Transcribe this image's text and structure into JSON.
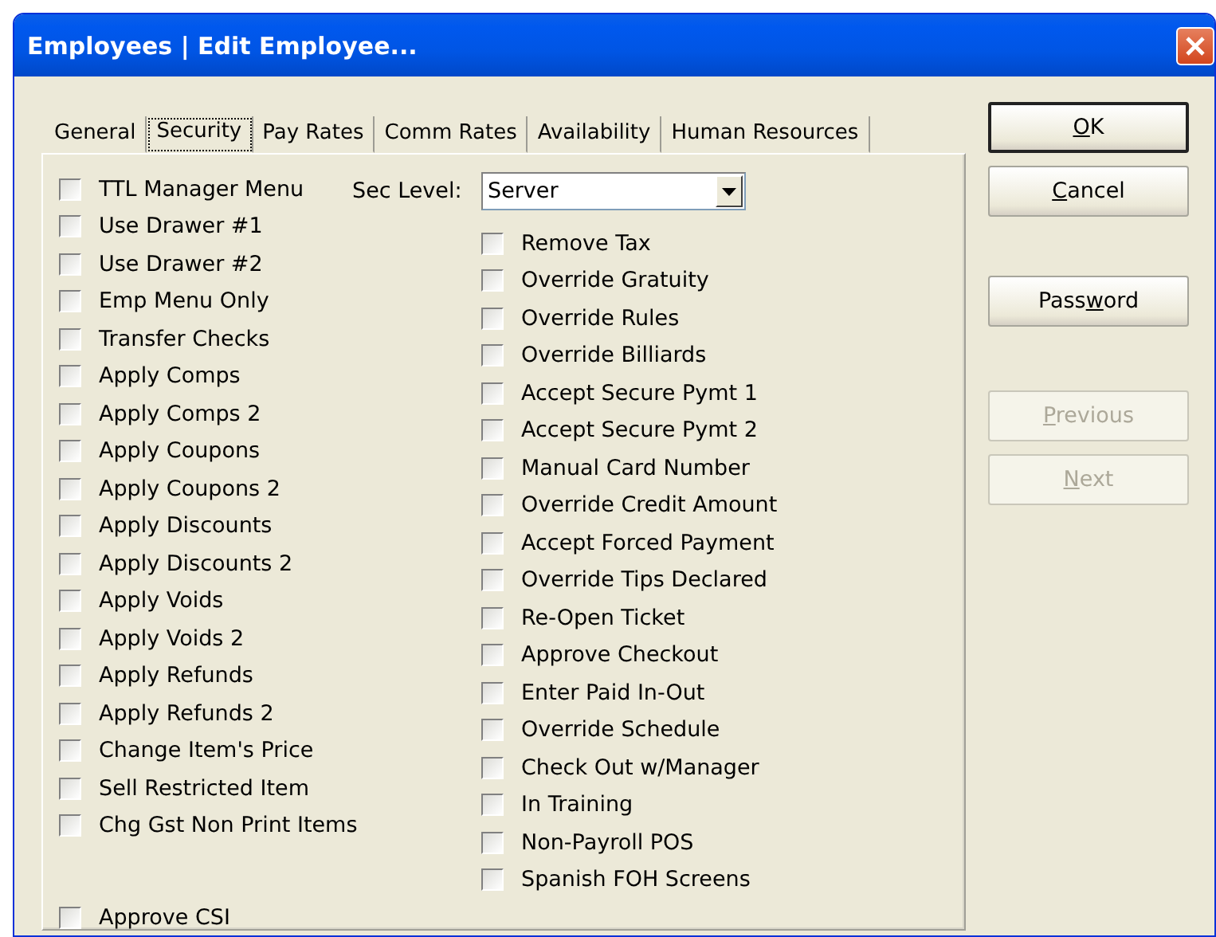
{
  "window": {
    "title": "Employees | Edit Employee..."
  },
  "tabs": [
    {
      "label": "General",
      "selected": false
    },
    {
      "label": "Security",
      "selected": true
    },
    {
      "label": "Pay Rates",
      "selected": false
    },
    {
      "label": "Comm Rates",
      "selected": false
    },
    {
      "label": "Availability",
      "selected": false
    },
    {
      "label": "Human Resources",
      "selected": false
    }
  ],
  "sec_level": {
    "label": "Sec Level:",
    "value": "Server"
  },
  "left_checkboxes": [
    {
      "label": "TTL Manager Menu",
      "checked": false
    },
    {
      "label": "Use Drawer #1",
      "checked": false
    },
    {
      "label": "Use Drawer #2",
      "checked": false
    },
    {
      "label": "Emp Menu Only",
      "checked": false
    },
    {
      "label": "Transfer Checks",
      "checked": false
    },
    {
      "label": "Apply Comps",
      "checked": false
    },
    {
      "label": "Apply Comps 2",
      "checked": false
    },
    {
      "label": "Apply Coupons",
      "checked": false
    },
    {
      "label": "Apply Coupons 2",
      "checked": false
    },
    {
      "label": "Apply Discounts",
      "checked": false
    },
    {
      "label": "Apply Discounts 2",
      "checked": false
    },
    {
      "label": "Apply Voids",
      "checked": false
    },
    {
      "label": "Apply Voids 2",
      "checked": false
    },
    {
      "label": "Apply Refunds",
      "checked": false
    },
    {
      "label": "Apply Refunds 2",
      "checked": false
    },
    {
      "label": "Change Item's Price",
      "checked": false
    },
    {
      "label": "Sell Restricted Item",
      "checked": false
    },
    {
      "label": "Chg Gst Non Print Items",
      "checked": false
    }
  ],
  "bottom_checkbox": {
    "label": "Approve CSI",
    "checked": false
  },
  "right_checkboxes": [
    {
      "label": "Remove Tax",
      "checked": false
    },
    {
      "label": "Override Gratuity",
      "checked": false
    },
    {
      "label": "Override Rules",
      "checked": false
    },
    {
      "label": "Override Billiards",
      "checked": false
    },
    {
      "label": "Accept Secure Pymt 1",
      "checked": false
    },
    {
      "label": "Accept Secure Pymt 2",
      "checked": false
    },
    {
      "label": "Manual Card Number",
      "checked": false
    },
    {
      "label": "Override Credit Amount",
      "checked": false
    },
    {
      "label": "Accept Forced Payment",
      "checked": false
    },
    {
      "label": "Override Tips Declared",
      "checked": false
    },
    {
      "label": "Re-Open Ticket",
      "checked": false
    },
    {
      "label": "Approve Checkout",
      "checked": false
    },
    {
      "label": "Enter Paid In-Out",
      "checked": false
    },
    {
      "label": "Override Schedule",
      "checked": false
    },
    {
      "label": "Check Out w/Manager",
      "checked": false
    },
    {
      "label": "In Training",
      "checked": false
    },
    {
      "label": "Non-Payroll POS",
      "checked": false
    },
    {
      "label": "Spanish FOH Screens",
      "checked": false
    }
  ],
  "buttons": [
    {
      "key": "O",
      "post": "K",
      "disabled": false,
      "default": true
    },
    {
      "key": "C",
      "post": "ancel",
      "disabled": false,
      "default": false
    },
    {
      "pre": "Pass",
      "key": "w",
      "post": "ord",
      "disabled": false,
      "default": false
    },
    {
      "key": "P",
      "post": "revious",
      "disabled": true,
      "default": false
    },
    {
      "key": "N",
      "post": "ext",
      "disabled": true,
      "default": false
    }
  ]
}
